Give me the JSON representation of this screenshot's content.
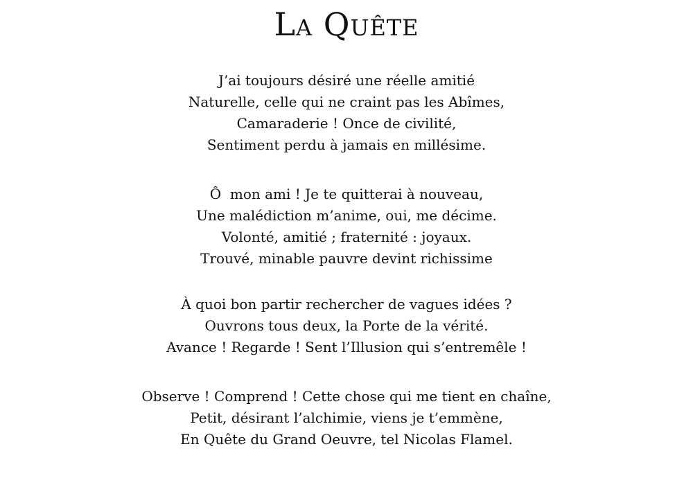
{
  "poem": {
    "title": "La Quête",
    "stanzas": [
      {
        "lines": [
          "J’ai toujours désiré une réelle amitié",
          "Naturelle, celle qui ne craint pas les Abîmes,",
          "Camaraderie ! Once de civilité,",
          "Sentiment perdu à jamais en millésime."
        ]
      },
      {
        "lines": [
          "Ô  mon ami ! Je te quitterai à nouveau,",
          "Une malédiction m’anime, oui, me décime.",
          "Volonté, amitié ; fraternité : joyaux.",
          "Trouvé, minable pauvre devint richissime"
        ]
      },
      {
        "lines": [
          "À quoi bon partir rechercher de vagues idées ?",
          "Ouvrons tous deux, la Porte de la vérité.",
          "Avance ! Regarde ! Sent l’Illusion qui s’entremêle !"
        ]
      },
      {
        "lines": [
          "Observe ! Comprend ! Cette chose qui me tient en chaîne,",
          "Petit, désirant l’alchimie, viens je t’emmène,",
          "En Quête du Grand Oeuvre, tel Nicolas Flamel."
        ]
      }
    ]
  }
}
